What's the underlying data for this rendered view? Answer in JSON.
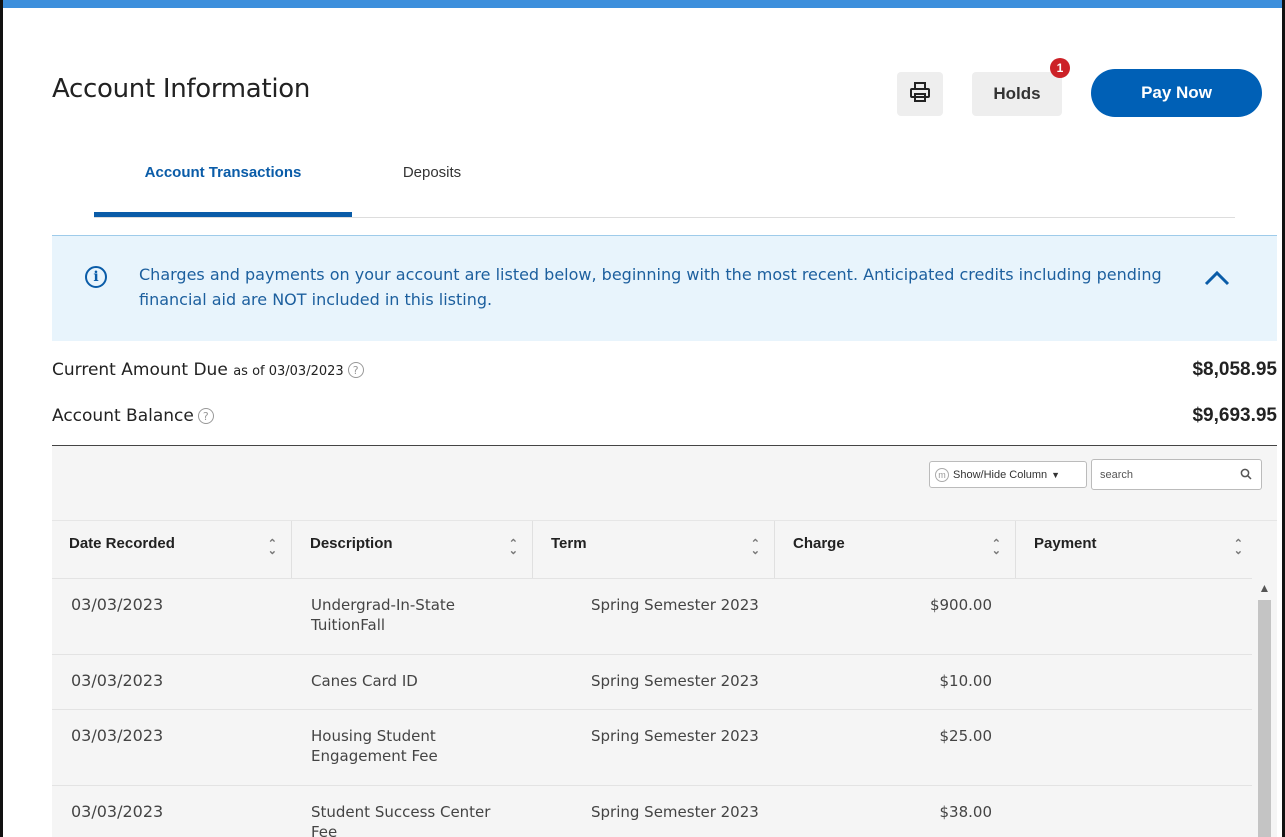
{
  "header": {
    "title": "Account Information",
    "holds_label": "Holds",
    "holds_count": "1",
    "pay_now_label": "Pay Now"
  },
  "tabs": [
    {
      "label": "Account Transactions",
      "active": true
    },
    {
      "label": "Deposits",
      "active": false
    }
  ],
  "info_banner": {
    "icon": "info-icon",
    "text": "Charges and payments on your account are listed below, beginning with the most recent. Anticipated credits including pending financial aid are NOT included in this listing."
  },
  "summary": {
    "current_due_label": "Current Amount Due",
    "current_due_asof": "as of 03/03/2023",
    "current_due_value": "$8,058.95",
    "balance_label": "Account Balance",
    "balance_value": "$9,693.95"
  },
  "table": {
    "show_hide_label": "Show/Hide Column",
    "search_placeholder": "search",
    "columns": [
      "Date Recorded",
      "Description",
      "Term",
      "Charge",
      "Payment"
    ],
    "rows": [
      {
        "date": "03/03/2023",
        "description": "Undergrad-In-State TuitionFall",
        "term": "Spring Semester 2023",
        "charge": "$900.00",
        "payment": ""
      },
      {
        "date": "03/03/2023",
        "description": "Canes Card ID",
        "term": "Spring Semester 2023",
        "charge": "$10.00",
        "payment": ""
      },
      {
        "date": "03/03/2023",
        "description": "Housing Student Engagement Fee",
        "term": "Spring Semester 2023",
        "charge": "$25.00",
        "payment": ""
      },
      {
        "date": "03/03/2023",
        "description": "Student Success Center Fee",
        "term": "Spring Semester 2023",
        "charge": "$38.00",
        "payment": ""
      }
    ]
  },
  "colors": {
    "accent": "#0a5ca8",
    "pay_now_bg": "#0060b6",
    "badge": "#cc2127",
    "banner_bg": "#e8f4fc"
  }
}
